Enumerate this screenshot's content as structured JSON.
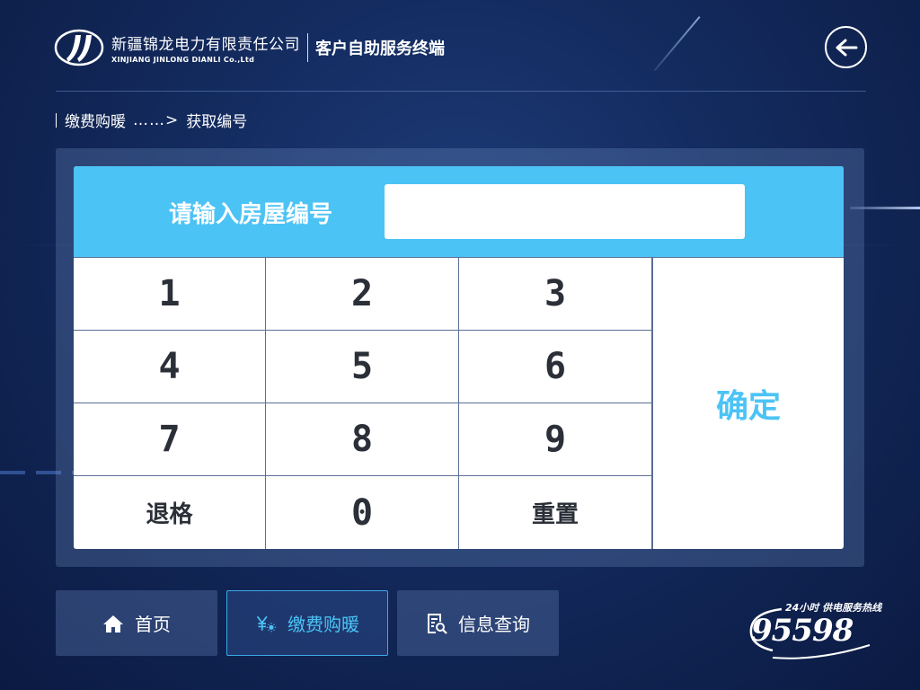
{
  "header": {
    "company_cn": "新疆锦龙电力有限责任公司",
    "company_en": "XINJIANG JINLONG DIANLI Co.,Ltd",
    "terminal_title": "客户自助服务终端",
    "back_icon": "arrow-left-icon"
  },
  "breadcrumb": {
    "parent": "缴费购暖",
    "separator": "……>",
    "current": "获取编号"
  },
  "keypad": {
    "prompt": "请输入房屋编号",
    "input_value": "",
    "input_placeholder": "",
    "keys": {
      "k1": "1",
      "k2": "2",
      "k3": "3",
      "k4": "4",
      "k5": "5",
      "k6": "6",
      "k7": "7",
      "k8": "8",
      "k9": "9",
      "backspace": "退格",
      "k0": "0",
      "reset": "重置"
    },
    "confirm": "确定",
    "accent_color": "#4cc3f5"
  },
  "nav": {
    "home": "首页",
    "pay_heating": "缴费购暖",
    "info_query": "信息查询",
    "active": "pay_heating"
  },
  "hotline": {
    "tagline": "24小时 供电服务热线",
    "number": "95598"
  }
}
